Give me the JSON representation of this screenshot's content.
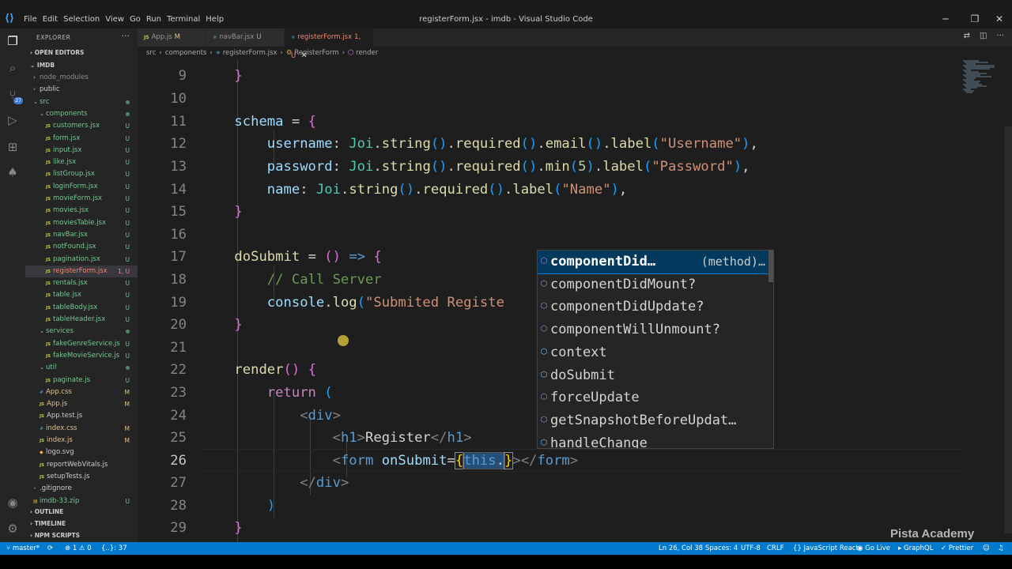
{
  "window": {
    "title": "registerForm.jsx - imdb - Visual Studio Code",
    "menu": [
      "File",
      "Edit",
      "Selection",
      "View",
      "Go",
      "Run",
      "Terminal",
      "Help"
    ]
  },
  "activity": {
    "scm_badge": "27"
  },
  "sidebar": {
    "header": "EXPLORER",
    "open_editors": "OPEN EDITORS",
    "root": "IMDB",
    "outline": "OUTLINE",
    "timeline": "TIMELINE",
    "npm_scripts": "NPM SCRIPTS",
    "tree": [
      {
        "label": "node_modules",
        "type": "folder",
        "status": ""
      },
      {
        "label": "public",
        "type": "folder",
        "status": ""
      },
      {
        "label": "src",
        "type": "folder-open",
        "status": "dot"
      },
      {
        "label": "components",
        "type": "folder-open",
        "status": "dot"
      },
      {
        "label": "customers.jsx",
        "type": "js",
        "status": "U"
      },
      {
        "label": "form.jsx",
        "type": "js",
        "status": "U"
      },
      {
        "label": "input.jsx",
        "type": "js",
        "status": "U"
      },
      {
        "label": "like.jsx",
        "type": "js",
        "status": "U"
      },
      {
        "label": "listGroup.jsx",
        "type": "js",
        "status": "U"
      },
      {
        "label": "loginForm.jsx",
        "type": "js",
        "status": "U"
      },
      {
        "label": "movieForm.jsx",
        "type": "js",
        "status": "U"
      },
      {
        "label": "movies.jsx",
        "type": "js",
        "status": "U"
      },
      {
        "label": "moviesTable.jsx",
        "type": "js",
        "status": "U"
      },
      {
        "label": "navBar.jsx",
        "type": "js",
        "status": "U"
      },
      {
        "label": "notFound.jsx",
        "type": "js",
        "status": "U"
      },
      {
        "label": "pagination.jsx",
        "type": "js",
        "status": "U"
      },
      {
        "label": "registerForm.jsx",
        "type": "js",
        "status": "1, U"
      },
      {
        "label": "rentals.jsx",
        "type": "js",
        "status": "U"
      },
      {
        "label": "table.jsx",
        "type": "js",
        "status": "U"
      },
      {
        "label": "tableBody.jsx",
        "type": "js",
        "status": "U"
      },
      {
        "label": "tableHeader.jsx",
        "type": "js",
        "status": "U"
      },
      {
        "label": "services",
        "type": "folder-open",
        "status": "dot"
      },
      {
        "label": "fakeGenreService.js",
        "type": "js",
        "status": "U"
      },
      {
        "label": "fakeMovieService.js",
        "type": "js",
        "status": "U"
      },
      {
        "label": "util",
        "type": "folder-open",
        "status": "dot"
      },
      {
        "label": "paginate.js",
        "type": "js",
        "status": "U"
      },
      {
        "label": "App.css",
        "type": "css",
        "status": "M"
      },
      {
        "label": "App.js",
        "type": "js",
        "status": "M"
      },
      {
        "label": "App.test.js",
        "type": "js",
        "status": ""
      },
      {
        "label": "index.css",
        "type": "css",
        "status": "M"
      },
      {
        "label": "index.js",
        "type": "js",
        "status": "M"
      },
      {
        "label": "logo.svg",
        "type": "svg",
        "status": ""
      },
      {
        "label": "reportWebVitals.js",
        "type": "js",
        "status": ""
      },
      {
        "label": "setupTests.js",
        "type": "js",
        "status": ""
      },
      {
        "label": ".gitignore",
        "type": "file",
        "status": ""
      },
      {
        "label": "imdb-33.zip",
        "type": "zip",
        "status": "U"
      }
    ]
  },
  "tabs": [
    {
      "label": "App.js",
      "status": "M",
      "active": false
    },
    {
      "label": "navBar.jsx",
      "status": "U",
      "active": false
    },
    {
      "label": "registerForm.jsx",
      "status": "1, U",
      "active": true
    }
  ],
  "breadcrumb": [
    "src",
    "components",
    "registerForm.jsx",
    "RegisterForm",
    "render"
  ],
  "editor": {
    "lines": [
      9,
      10,
      11,
      12,
      13,
      14,
      15,
      16,
      17,
      18,
      19,
      20,
      21,
      22,
      23,
      24,
      25,
      26,
      27,
      28,
      29
    ],
    "current_line": 26
  },
  "suggest": {
    "items": [
      {
        "label": "componentDid…",
        "detail": "(method)…",
        "selected": true
      },
      {
        "label": "componentDidMount?",
        "detail": ""
      },
      {
        "label": "componentDidUpdate?",
        "detail": ""
      },
      {
        "label": "componentWillUnmount?",
        "detail": ""
      },
      {
        "label": "context",
        "detail": ""
      },
      {
        "label": "doSubmit",
        "detail": ""
      },
      {
        "label": "forceUpdate",
        "detail": ""
      },
      {
        "label": "getSnapshotBeforeUpdat…",
        "detail": ""
      },
      {
        "label": "handleChange",
        "detail": ""
      }
    ]
  },
  "status": {
    "branch": "master*",
    "problems": "⊗ 1 ⚠ 0",
    "position_hint": "{..}: 37",
    "cursor": "Ln 26, Col 38",
    "spaces": "Spaces: 4",
    "encoding": "UTF-8",
    "eol": "CRLF",
    "language": "JavaScript React",
    "golive": "Go Live",
    "graphql": "GraphQL",
    "prettier": "Prettier"
  },
  "watermark": "Pista Academy"
}
